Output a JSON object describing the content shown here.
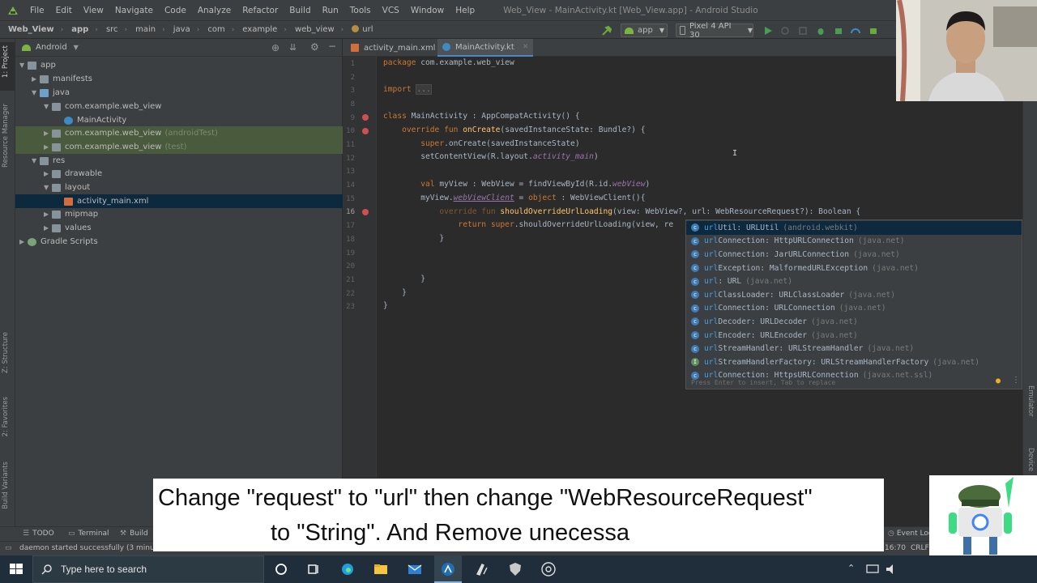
{
  "menu": {
    "items": [
      "File",
      "Edit",
      "View",
      "Navigate",
      "Code",
      "Analyze",
      "Refactor",
      "Build",
      "Run",
      "Tools",
      "VCS",
      "Window",
      "Help"
    ],
    "window_title": "Web_View - MainActivity.kt [Web_View.app] - Android Studio"
  },
  "navbar": {
    "breadcrumbs": [
      "Web_View",
      "app",
      "src",
      "main",
      "java",
      "com",
      "example",
      "web_view",
      "url"
    ],
    "run_config": "app",
    "device": "Pixel 4 API 30"
  },
  "left_stripe": {
    "tabs": [
      "1: Project",
      "Resource Manager",
      "Z: Structure",
      "2: Favorites",
      "Build Variants"
    ]
  },
  "right_stripe": {
    "tabs": [
      "Emulator",
      "Device"
    ]
  },
  "project_panel": {
    "view_mode": "Android",
    "tree": [
      {
        "label": "app",
        "suffix": "",
        "indent": 0,
        "icon": "folder"
      },
      {
        "label": "manifests",
        "suffix": "",
        "indent": 1,
        "icon": "folder"
      },
      {
        "label": "java",
        "suffix": "",
        "indent": 1,
        "icon": "folderblue"
      },
      {
        "label": "com.example.web_view",
        "suffix": "",
        "indent": 2,
        "icon": "folder"
      },
      {
        "label": "MainActivity",
        "suffix": "",
        "indent": 3,
        "icon": "kt"
      },
      {
        "label": "com.example.web_view",
        "suffix": "(androidTest)",
        "indent": 2,
        "icon": "folder"
      },
      {
        "label": "com.example.web_view",
        "suffix": "(test)",
        "indent": 2,
        "icon": "folder"
      },
      {
        "label": "res",
        "suffix": "",
        "indent": 1,
        "icon": "folder"
      },
      {
        "label": "drawable",
        "suffix": "",
        "indent": 2,
        "icon": "folder"
      },
      {
        "label": "layout",
        "suffix": "",
        "indent": 2,
        "icon": "folder"
      },
      {
        "label": "activity_main.xml",
        "suffix": "",
        "indent": 3,
        "icon": "xml"
      },
      {
        "label": "mipmap",
        "suffix": "",
        "indent": 2,
        "icon": "folder"
      },
      {
        "label": "values",
        "suffix": "",
        "indent": 2,
        "icon": "folder"
      },
      {
        "label": "Gradle Scripts",
        "suffix": "",
        "indent": 0,
        "icon": "gradle"
      }
    ]
  },
  "tabs": [
    {
      "label": "activity_main.xml"
    },
    {
      "label": "MainActivity.kt"
    }
  ],
  "editor": {
    "line_numbers": [
      "1",
      "2",
      "3",
      "8",
      "9",
      "10",
      "11",
      "12",
      "13",
      "14",
      "15",
      "16",
      "17",
      "18",
      "19",
      "20",
      "21",
      "22",
      "23"
    ],
    "code": {
      "l1_kw": "package",
      "l1_rest": " com.example.web_view",
      "l3_kw": "import",
      "l3_fold": "...",
      "l9_kw": "class",
      "l9_rest": " MainActivity : AppCompatActivity() {",
      "l10_kw": "override fun",
      "l10_fn": "onCreate",
      "l10_rest": "(savedInstanceState: Bundle?) {",
      "l11_kw": "super",
      "l11_rest": ".onCreate(savedInstanceState)",
      "l12_pre": "setContentView(R.layout.",
      "l12_it": "activity_main",
      "l12_post": ")",
      "l14_kw": "val",
      "l14_rest": " myView : WebView = findViewById(R.id.",
      "l14_it": "webView",
      "l14_post": ")",
      "l15_pre": "myView.",
      "l15_it": "webViewClient",
      "l15_mid": " = ",
      "l15_kw": "object",
      "l15_post": " : WebViewClient(){",
      "l16_kw": "override fun",
      "l16_fn": "shouldOverrideUrlLoading",
      "l16_rest": "(view: WebView?, url: WebResourceRequest?): Boolean {",
      "l17_kw": "return",
      "l17_kw2": "super",
      "l17_rest": ".shouldOverrideUrlLoading(view, re",
      "l18": "}",
      "l21": "}",
      "l22": "}",
      "l23": "}"
    }
  },
  "completion": {
    "items": [
      {
        "match": "url",
        "rest": "Util: URLUtil",
        "pkg": "(android.webkit)",
        "kind": "class"
      },
      {
        "match": "url",
        "rest": "Connection: HttpURLConnection",
        "pkg": "(java.net)",
        "kind": "class"
      },
      {
        "match": "url",
        "rest": "Connection: JarURLConnection",
        "pkg": "(java.net)",
        "kind": "class"
      },
      {
        "match": "url",
        "rest": "Exception: MalformedURLException",
        "pkg": "(java.net)",
        "kind": "class"
      },
      {
        "match": "url",
        "rest": ": URL",
        "pkg": "(java.net)",
        "kind": "class"
      },
      {
        "match": "url",
        "rest": "ClassLoader: URLClassLoader",
        "pkg": "(java.net)",
        "kind": "class"
      },
      {
        "match": "url",
        "rest": "Connection: URLConnection",
        "pkg": "(java.net)",
        "kind": "class"
      },
      {
        "match": "url",
        "rest": "Decoder: URLDecoder",
        "pkg": "(java.net)",
        "kind": "class"
      },
      {
        "match": "url",
        "rest": "Encoder: URLEncoder",
        "pkg": "(java.net)",
        "kind": "class"
      },
      {
        "match": "url",
        "rest": "StreamHandler: URLStreamHandler",
        "pkg": "(java.net)",
        "kind": "class"
      },
      {
        "match": "url",
        "rest": "StreamHandlerFactory: URLStreamHandlerFactory",
        "pkg": "(java.net)",
        "kind": "interface"
      },
      {
        "match": "url",
        "rest": "Connection: HttpsURLConnection",
        "pkg": "(javax.net.ssl)",
        "kind": "class"
      }
    ],
    "footer": "Press Enter to insert, Tab to replace"
  },
  "bottom_tabs": [
    "TODO",
    "Terminal",
    "Build"
  ],
  "status": {
    "message": "daemon started successfully (3 minu",
    "event_log": "Event Log",
    "position": "16:70",
    "line_sep": "CRLF"
  },
  "caption": {
    "line1": "Change \"request\" to \"url\" then change \"WebResourceRequest\"",
    "line2": "to \"String\". And Remove unecessa"
  },
  "taskbar": {
    "search_placeholder": "Type here to search"
  },
  "colors": {
    "accent": "#4a88c7",
    "keyword": "#cc7832",
    "function": "#ffc66d",
    "property": "#9876aa"
  }
}
